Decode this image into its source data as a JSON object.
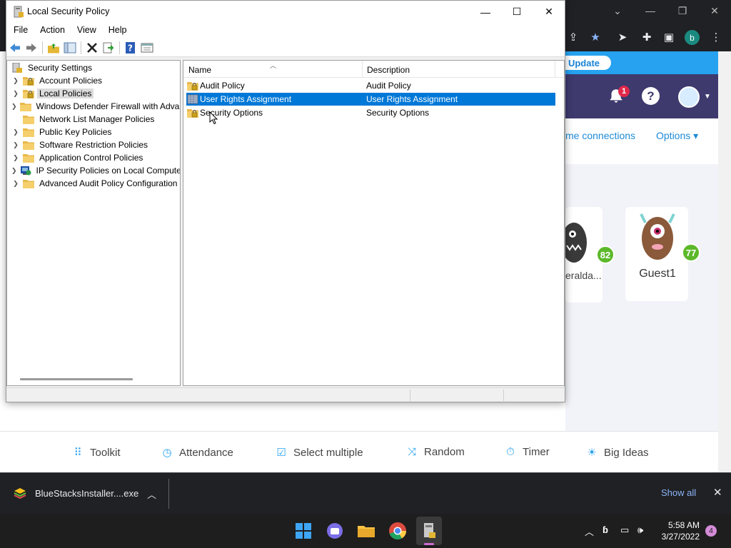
{
  "window": {
    "title": "Local Security Policy",
    "minimize_glyph": "—",
    "maximize_glyph": "☐",
    "close_glyph": "✕"
  },
  "menu": [
    "File",
    "Action",
    "View",
    "Help"
  ],
  "toolbar_icons": [
    "back-icon",
    "forward-icon",
    "up-folder-icon",
    "show-hide-tree-icon",
    "delete-icon",
    "export-list-icon",
    "help-icon",
    "properties-icon"
  ],
  "tree": {
    "root": "Security Settings",
    "items": [
      {
        "label": "Account Policies",
        "expandable": true,
        "icon": "folder-lock-icon"
      },
      {
        "label": "Local Policies",
        "expandable": true,
        "selected": true,
        "icon": "folder-lock-icon"
      },
      {
        "label": "Windows Defender Firewall with Adva",
        "expandable": true,
        "icon": "folder-icon"
      },
      {
        "label": "Network List Manager Policies",
        "expandable": false,
        "icon": "folder-icon"
      },
      {
        "label": "Public Key Policies",
        "expandable": true,
        "icon": "folder-icon"
      },
      {
        "label": "Software Restriction Policies",
        "expandable": true,
        "icon": "folder-icon"
      },
      {
        "label": "Application Control Policies",
        "expandable": true,
        "icon": "folder-icon"
      },
      {
        "label": "IP Security Policies on Local Compute",
        "expandable": true,
        "icon": "ip-security-icon"
      },
      {
        "label": "Advanced Audit Policy Configuration",
        "expandable": true,
        "icon": "folder-icon"
      }
    ]
  },
  "list": {
    "columns": [
      "Name",
      "Description"
    ],
    "rows": [
      {
        "name": "Audit Policy",
        "description": "Audit Policy",
        "selected": false
      },
      {
        "name": "User Rights Assignment",
        "description": "User Rights Assignment",
        "selected": true
      },
      {
        "name": "Security Options",
        "description": "Security Options",
        "selected": false
      }
    ]
  },
  "background_app": {
    "update_button": "Update",
    "notification_count": "1",
    "help_glyph": "?",
    "nav_connections": "me connections",
    "nav_options": "Options ▾",
    "students": [
      {
        "name": "eralda...",
        "score": "82"
      },
      {
        "name": "Guest1",
        "score": "77"
      }
    ],
    "tools": [
      "Toolkit",
      "Attendance",
      "Select multiple",
      "Random",
      "Timer",
      "Big Ideas"
    ],
    "profile_letter": "b"
  },
  "download_bar": {
    "file": "BlueStacksInstaller....exe",
    "show_all": "Show all",
    "close_glyph": "✕",
    "caret_glyph": "︿"
  },
  "taskbar": {
    "time": "5:58 AM",
    "date": "3/27/2022",
    "notification_count": "4",
    "tray_chevron": "︿"
  },
  "colors": {
    "selection_blue": "#0078d7",
    "dojo_blue": "#26a2f0",
    "dojo_purple": "#3e3a6e",
    "score_green": "#5cb82a"
  }
}
